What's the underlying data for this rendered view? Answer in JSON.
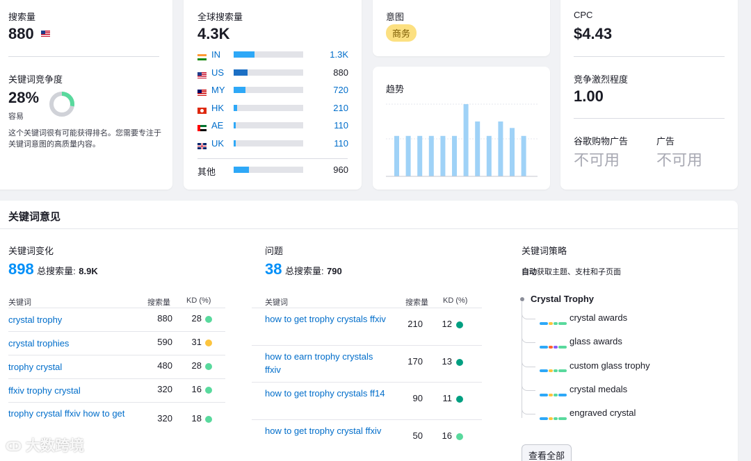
{
  "volume": {
    "label": "搜索量",
    "value": "880"
  },
  "kd": {
    "label": "关键词竞争度",
    "value": "28%",
    "level": "容易",
    "percent": 28,
    "desc": "这个关键词很有可能获得排名。您需要专注于关键词意图的高质量内容。"
  },
  "global": {
    "label": "全球搜索量",
    "value": "4.3K",
    "countries": [
      {
        "code": "IN",
        "value": "1.3K",
        "fill": 0.3,
        "linked": true,
        "flag": "in-flag-icon"
      },
      {
        "code": "US",
        "value": "880",
        "fill": 0.2,
        "linked": false,
        "flag": "us-flag-icon"
      },
      {
        "code": "MY",
        "value": "720",
        "fill": 0.17,
        "linked": true,
        "flag": "my-flag-icon"
      },
      {
        "code": "HK",
        "value": "210",
        "fill": 0.05,
        "linked": true,
        "flag": "hk-flag-icon"
      },
      {
        "code": "AE",
        "value": "110",
        "fill": 0.03,
        "linked": true,
        "flag": "ae-flag-icon"
      },
      {
        "code": "UK",
        "value": "110",
        "fill": 0.03,
        "linked": true,
        "flag": "uk-flag-icon"
      }
    ],
    "other_label": "其他",
    "other_value": "960",
    "other_fill": 0.22
  },
  "intent": {
    "label": "意图",
    "badge": "商务"
  },
  "trend": {
    "label": "趋势",
    "values": [
      0.56,
      0.56,
      0.56,
      0.56,
      0.56,
      0.56,
      1.0,
      0.76,
      0.56,
      0.76,
      0.67,
      0.56
    ]
  },
  "cpc": {
    "label": "CPC",
    "value": "$4.43"
  },
  "competition": {
    "label": "竞争激烈程度",
    "value": "1.00"
  },
  "shopping": {
    "label": "谷歌购物广告",
    "value": "不可用"
  },
  "ads": {
    "label": "广告",
    "value": "不可用"
  },
  "ideas": {
    "title": "关键词意见",
    "variations": {
      "label": "关键词变化",
      "count": "898",
      "total_label": "总搜索量:",
      "total": "8.9K",
      "headers": {
        "kw": "关键词",
        "vol": "搜索量",
        "kd": "KD (%)"
      },
      "rows": [
        {
          "kw": "crystal trophy",
          "vol": "880",
          "kd": "28",
          "color": "#59d99d"
        },
        {
          "kw": "crystal trophies",
          "vol": "590",
          "kd": "31",
          "color": "#fcc43e"
        },
        {
          "kw": "trophy crystal",
          "vol": "480",
          "kd": "28",
          "color": "#59d99d"
        },
        {
          "kw": "ffxiv trophy crystal",
          "vol": "320",
          "kd": "16",
          "color": "#59d99d"
        },
        {
          "kw": "trophy crystal ffxiv how to get",
          "vol": "320",
          "kd": "18",
          "color": "#59d99d"
        }
      ]
    },
    "questions": {
      "label": "问题",
      "count": "38",
      "total_label": "总搜索量:",
      "total": "790",
      "headers": {
        "kw": "关键词",
        "vol": "搜索量",
        "kd": "KD (%)"
      },
      "rows": [
        {
          "kw": "how to get trophy crystals ffxiv",
          "vol": "210",
          "kd": "12",
          "color": "#009f81"
        },
        {
          "kw": "how to earn trophy crystals ffxiv",
          "vol": "170",
          "kd": "13",
          "color": "#009f81"
        },
        {
          "kw": "how to get trophy crystals ff14",
          "vol": "90",
          "kd": "11",
          "color": "#009f81"
        },
        {
          "kw": "how to get trophy crystal ffxiv",
          "vol": "50",
          "kd": "16",
          "color": "#59d99d"
        }
      ]
    },
    "strategy": {
      "label": "关键词策略",
      "sub_bold": "自动",
      "sub_rest": "获取主题、支柱和子页面",
      "root": "Crystal Trophy",
      "children": [
        "crystal awards",
        "glass awards",
        "custom glass trophy",
        "crystal medals",
        "engraved crystal"
      ],
      "view_all": "查看全部"
    }
  },
  "watermark": "大数跨境"
}
